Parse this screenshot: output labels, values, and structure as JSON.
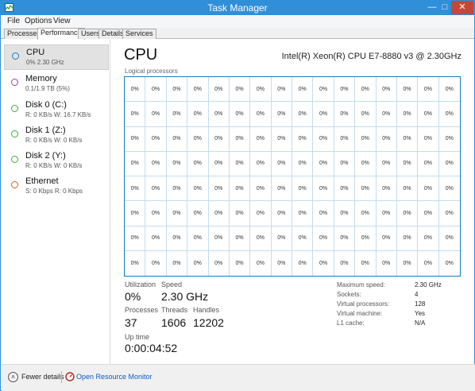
{
  "window": {
    "title": "Task Manager",
    "minimize": "—",
    "maximize": "□",
    "close": "✕"
  },
  "menu": [
    "File",
    "Options",
    "View"
  ],
  "tabs": [
    "Processes",
    "Performance",
    "Users",
    "Details",
    "Services"
  ],
  "active_tab": "Performance",
  "sidebar": {
    "items": [
      {
        "name": "CPU",
        "sub": "0% 2.30 GHz",
        "color": "#1e79c4",
        "selected": true
      },
      {
        "name": "Memory",
        "sub": "0.1/1.9 TB (5%)",
        "color": "#a33bb5",
        "selected": false
      },
      {
        "name": "Disk 0 (C:)",
        "sub": "R: 0 KB/s W: 16.7 KB/s",
        "color": "#4aa83a",
        "selected": false
      },
      {
        "name": "Disk 1 (Z:)",
        "sub": "R: 0 KB/s W: 0 KB/s",
        "color": "#4aa83a",
        "selected": false
      },
      {
        "name": "Disk 2 (Y:)",
        "sub": "R: 0 KB/s W: 0 KB/s",
        "color": "#4aa83a",
        "selected": false
      },
      {
        "name": "Ethernet",
        "sub": "S: 0 Kbps R: 0 Kbps",
        "color": "#c8651b",
        "selected": false
      }
    ]
  },
  "main": {
    "title": "CPU",
    "model": "Intel(R) Xeon(R) CPU E7-8880 v3 @ 2.30GHz",
    "graph_label": "Logical processors",
    "processors": {
      "count": 128,
      "rows": 8,
      "columns": 16,
      "usage_label": "0%"
    },
    "stats": {
      "utilization_label": "Utilization",
      "utilization_value": "0%",
      "speed_label": "Speed",
      "speed_value": "2.30 GHz",
      "processes_label": "Processes",
      "processes_value": "37",
      "threads_label": "Threads",
      "threads_value": "1606",
      "handles_label": "Handles",
      "handles_value": "12202",
      "uptime_label": "Up time",
      "uptime_value": "0:00:04:52"
    },
    "specs": [
      {
        "label": "Maximum speed:",
        "value": "2.30 GHz"
      },
      {
        "label": "Sockets:",
        "value": "4"
      },
      {
        "label": "Virtual processors:",
        "value": "128"
      },
      {
        "label": "Virtual machine:",
        "value": "Yes"
      },
      {
        "label": "L1 cache:",
        "value": "N/A"
      }
    ]
  },
  "footer": {
    "fewer_details": "Fewer details",
    "open_monitor": "Open Resource Monitor"
  },
  "colors": {
    "titlebar": "#2f8fd8",
    "graph_border": "#117dbb",
    "link": "#0c5bc7"
  }
}
